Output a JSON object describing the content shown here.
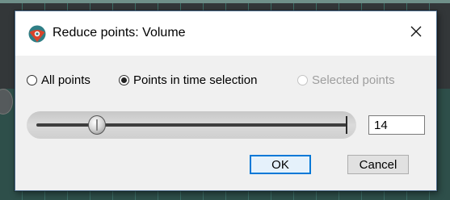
{
  "window": {
    "title": "Reduce points: Volume",
    "close_glyph": "✕"
  },
  "options": {
    "all_points": "All points",
    "time_selection": "Points in time selection",
    "selected_points": "Selected points",
    "checked": "time_selection",
    "disabled": "selected_points"
  },
  "slider": {
    "value": 14
  },
  "field": {
    "value": "14"
  },
  "buttons": {
    "ok": "OK",
    "cancel": "Cancel"
  },
  "colors": {
    "accent": "#0078d7",
    "icon_red": "#d9432a",
    "icon_teal": "#2f7f86"
  }
}
